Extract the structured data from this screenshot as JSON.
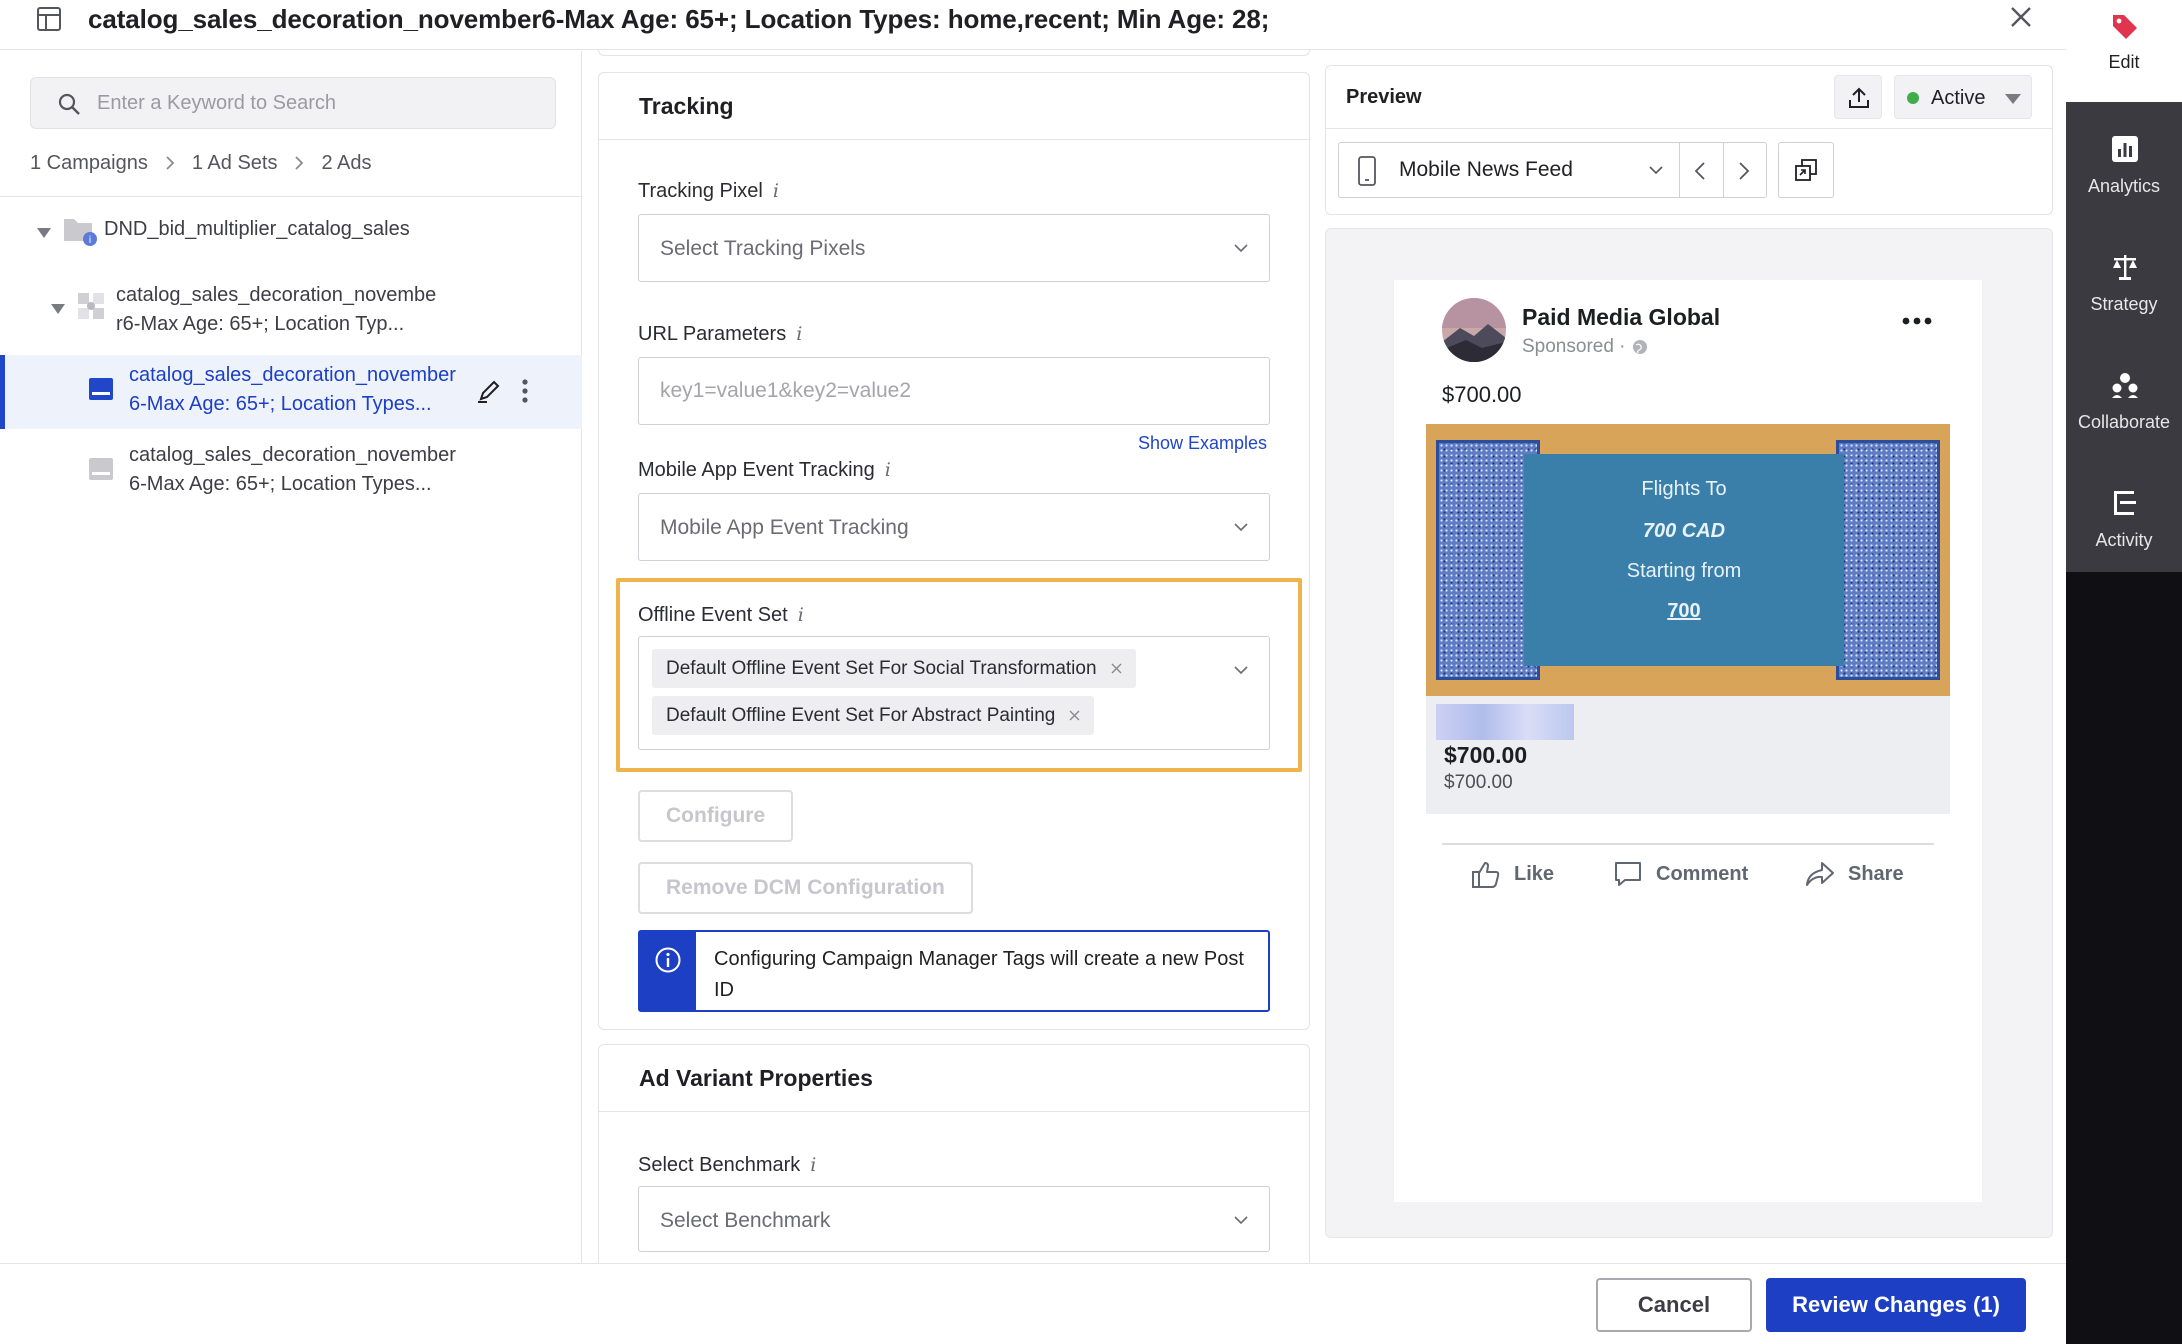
{
  "header": {
    "title": "catalog_sales_decoration_november6-Max Age: 65+; Location Types: home,recent; Min Age: 28;"
  },
  "sidebar": {
    "search": {
      "placeholder": "Enter a Keyword to Search",
      "value": ""
    },
    "breadcrumb": [
      "1 Campaigns",
      "1 Ad Sets",
      "2 Ads"
    ],
    "tree": {
      "campaign": "DND_bid_multiplier_catalog_sales",
      "adset": [
        "catalog_sales_decoration_novembe",
        "r6-Max Age: 65+; Location Typ..."
      ],
      "ads": [
        {
          "line1": "catalog_sales_decoration_november",
          "line2": "6-Max Age: 65+; Location Types...",
          "selected": true
        },
        {
          "line1": "catalog_sales_decoration_november",
          "line2": "6-Max Age: 65+; Location Types...",
          "selected": false
        }
      ]
    }
  },
  "tracking": {
    "title": "Tracking",
    "info_glyph": "i",
    "pixel": {
      "label": "Tracking Pixel",
      "placeholder": "Select Tracking Pixels"
    },
    "url_params": {
      "label": "URL Parameters",
      "placeholder": "key1=value1&key2=value2",
      "value": ""
    },
    "show_examples": "Show Examples",
    "mobile_app": {
      "label": "Mobile App Event Tracking",
      "placeholder": "Mobile App Event Tracking"
    },
    "offline": {
      "label": "Offline Event Set",
      "chips": [
        "Default Offline Event Set For Social Transformation",
        "Default Offline Event Set For Abstract Painting"
      ],
      "highlight_color": "#f0b44c"
    },
    "configure_label": "Configure",
    "remove_dcm_label": "Remove DCM Configuration",
    "info_banner": "Configuring Campaign Manager Tags will create a new Post ID"
  },
  "variant": {
    "title": "Ad Variant Properties",
    "benchmark": {
      "label": "Select Benchmark",
      "placeholder": "Select Benchmark"
    }
  },
  "preview": {
    "title": "Preview",
    "status": {
      "label": "Active",
      "color": "#3fae49"
    },
    "placement": "Mobile News Feed",
    "post": {
      "page_name": "Paid Media Global",
      "sponsored": "Sponsored ·",
      "price_top": "$700.00",
      "banner": [
        "Flights To",
        "700 CAD",
        "Starting from",
        "700"
      ],
      "price_bold": "$700.00",
      "price_small": "$700.00",
      "actions": [
        "Like",
        "Comment",
        "Share"
      ]
    }
  },
  "footer": {
    "cancel": "Cancel",
    "review": "Review Changes (1)"
  },
  "rail": {
    "items": [
      "Edit",
      "Analytics",
      "Strategy",
      "Collaborate",
      "Activity"
    ],
    "accent": "#e0344f"
  },
  "colors": {
    "primary": "#1c3fc4",
    "link": "#2146c7",
    "rail_bg": "#101014"
  }
}
